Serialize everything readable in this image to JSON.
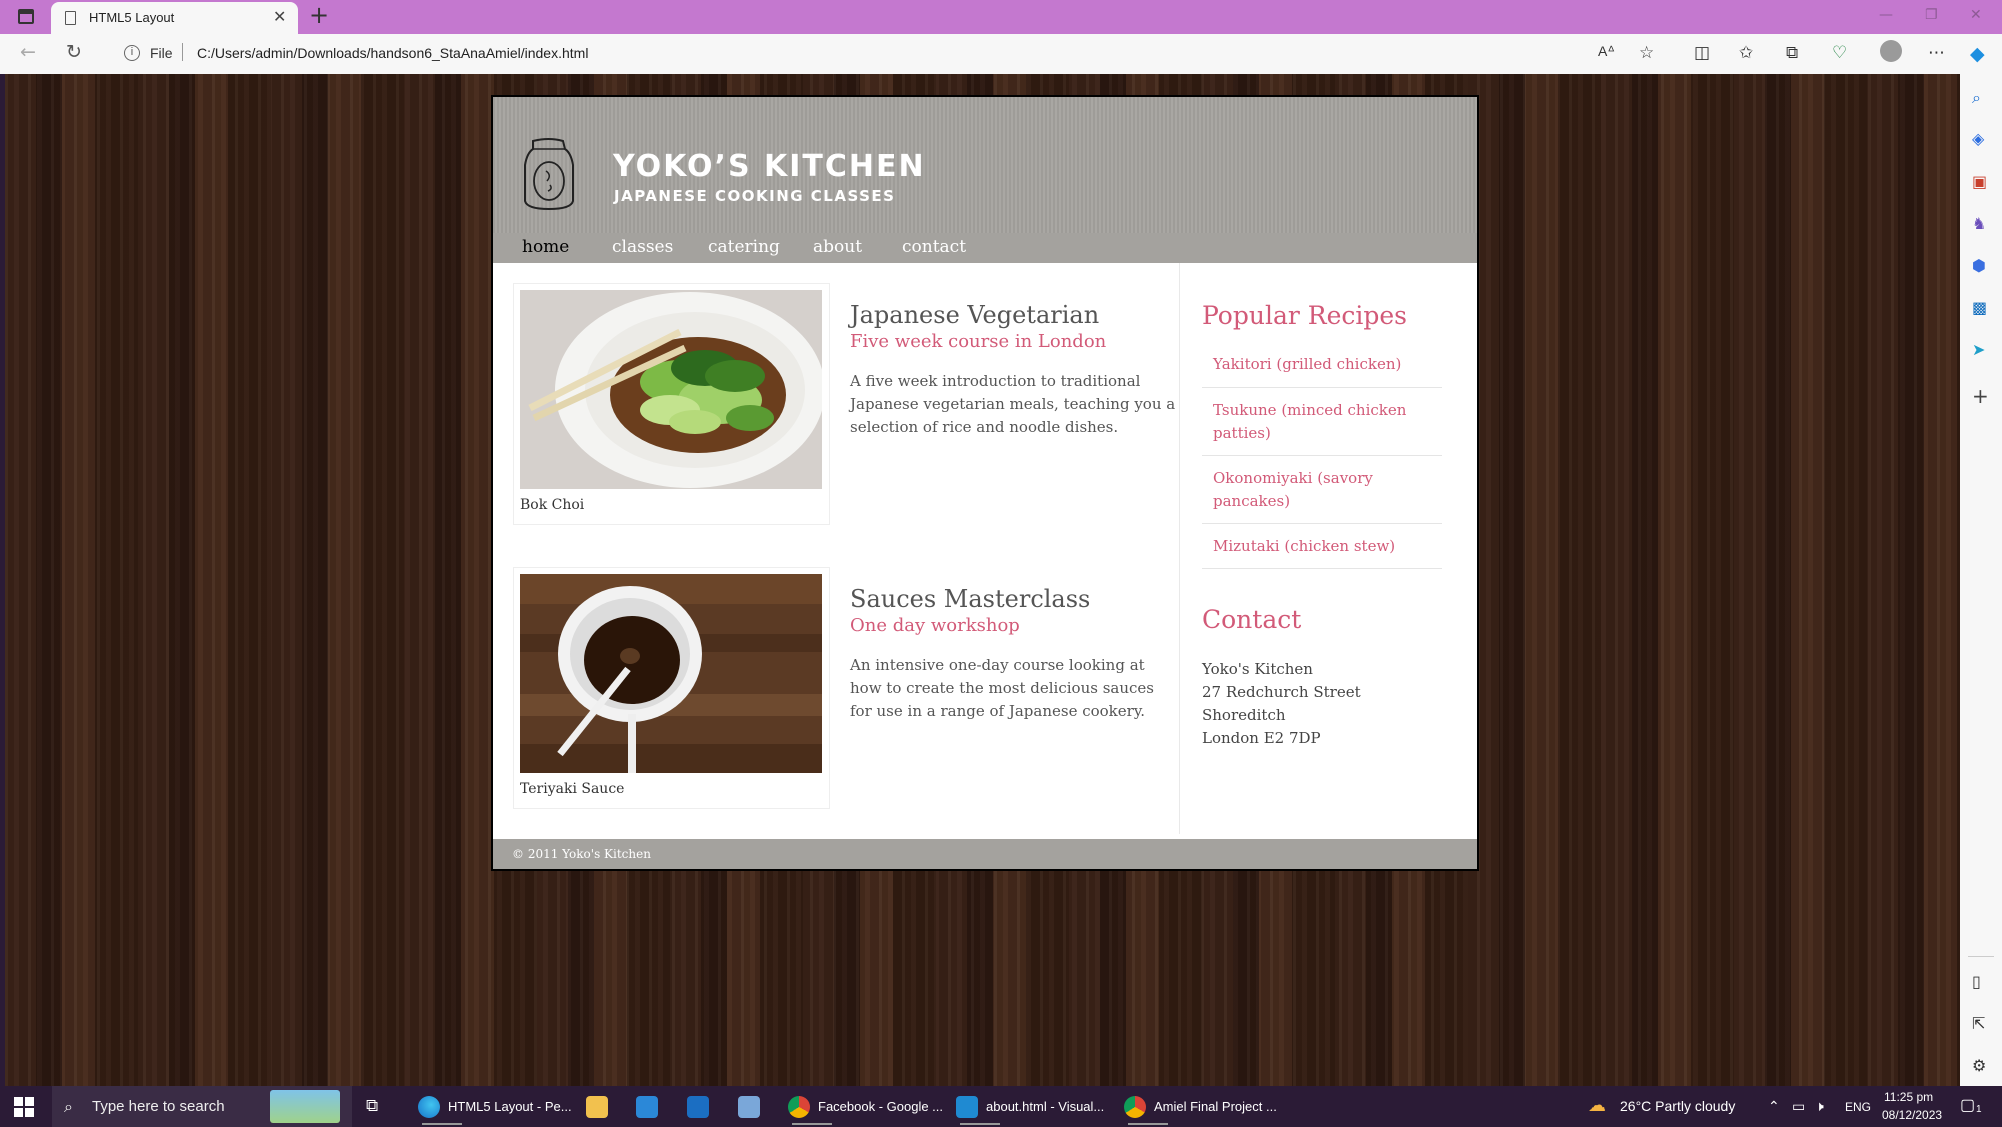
{
  "browser": {
    "tab_title": "HTML5 Layout",
    "address_prefix": "File",
    "url": "C:/Users/admin/Downloads/handson6_StaAnaAmiel/index.html"
  },
  "site": {
    "title": "YOKO’S KITCHEN",
    "tagline": "JAPANESE COOKING CLASSES",
    "nav": [
      "home",
      "classes",
      "catering",
      "about",
      "contact"
    ],
    "articles": [
      {
        "caption": "Bok Choi",
        "title": "Japanese Vegetarian",
        "subtitle": "Five week course in London",
        "body": "A five week introduction to traditional Japanese vegetarian meals, teaching you a selection of rice and noodle dishes."
      },
      {
        "caption": "Teriyaki Sauce",
        "title": "Sauces Masterclass",
        "subtitle": "One day workshop",
        "body": "An intensive one-day course looking at how to create the most delicious sauces for use in a range of Japanese cookery."
      }
    ],
    "aside": {
      "recipes_heading": "Popular Recipes",
      "recipes": [
        "Yakitori (grilled chicken)",
        "Tsukune (minced chicken patties)",
        "Okonomiyaki (savory pancakes)",
        "Mizutaki (chicken stew)"
      ],
      "contact_heading": "Contact",
      "address": [
        "Yoko's Kitchen",
        "27 Redchurch Street",
        "Shoreditch",
        "London E2 7DP"
      ]
    },
    "footer": "© 2011 Yoko's Kitchen",
    "accent_color": "#d25a78"
  },
  "taskbar": {
    "search_placeholder": "Type here to search",
    "apps": [
      {
        "label": "HTML5 Layout - Pe...",
        "icon": "edge-icon"
      },
      {
        "label": "",
        "icon": "file-explorer-icon"
      },
      {
        "label": "",
        "icon": "store-icon"
      },
      {
        "label": "",
        "icon": "mail-icon"
      },
      {
        "label": "",
        "icon": "app-icon"
      },
      {
        "label": "Facebook - Google ...",
        "icon": "chrome-icon"
      },
      {
        "label": "about.html - Visual...",
        "icon": "vscode-icon"
      },
      {
        "label": "Amiel Final Project ...",
        "icon": "chrome-icon"
      }
    ],
    "weather": "26°C  Partly cloudy",
    "language": "ENG",
    "time": "11:25 pm",
    "date": "08/12/2023",
    "notification_count": "1"
  }
}
